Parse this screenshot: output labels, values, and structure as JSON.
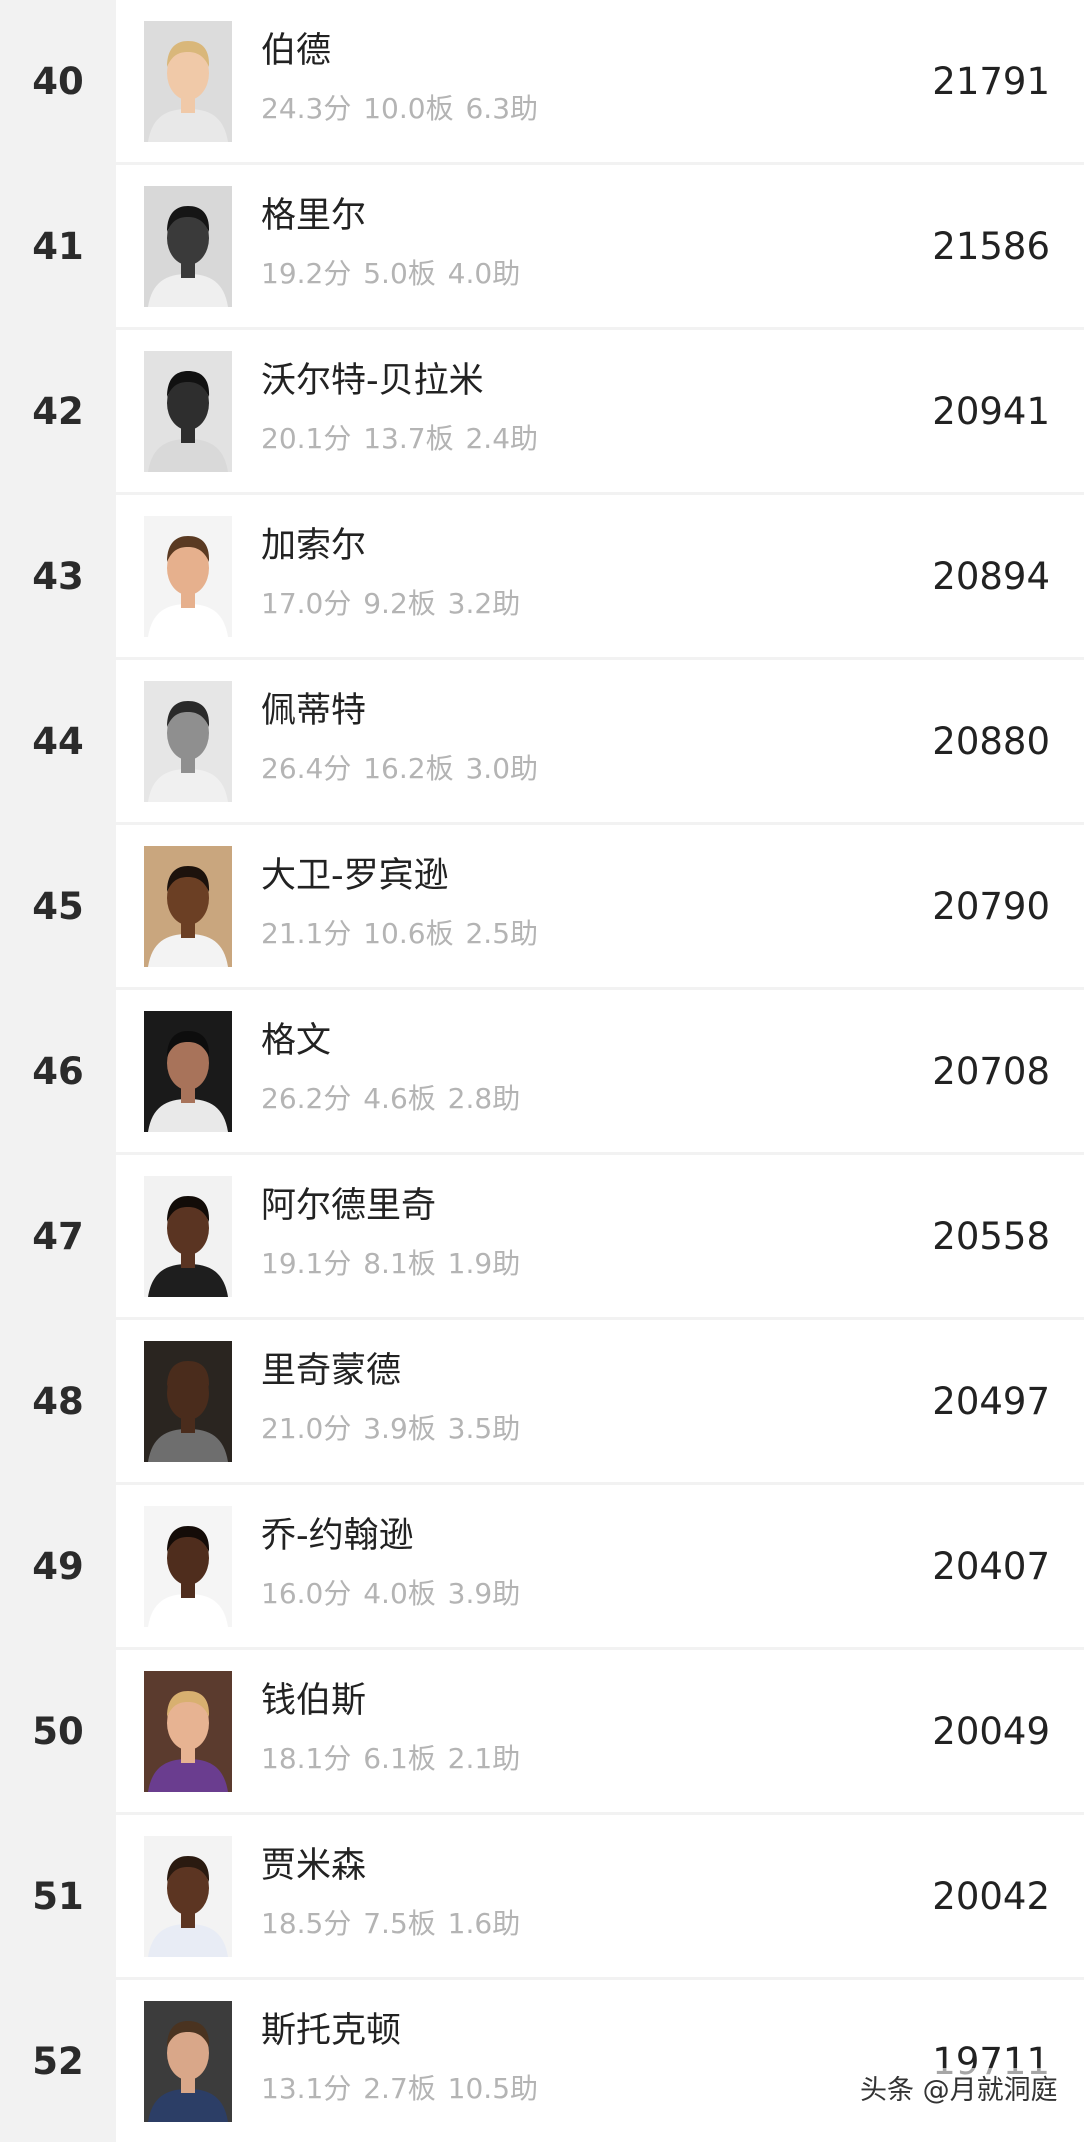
{
  "players": [
    {
      "rank": "40",
      "name": "伯德",
      "stats": "24.3分 10.0板 6.3助",
      "points": "21791",
      "photo": {
        "bg": "#dcdcdc",
        "skin": "#f0c9a8",
        "hair": "#d9b77a",
        "jersey": "#e8e8e8"
      }
    },
    {
      "rank": "41",
      "name": "格里尔",
      "stats": "19.2分 5.0板 4.0助",
      "points": "21586",
      "photo": {
        "bg": "#d8d8d8",
        "skin": "#3a3a3a",
        "hair": "#151515",
        "jersey": "#efefef"
      }
    },
    {
      "rank": "42",
      "name": "沃尔特-贝拉米",
      "stats": "20.1分 13.7板 2.4助",
      "points": "20941",
      "photo": {
        "bg": "#e2e2e2",
        "skin": "#2e2e2e",
        "hair": "#111111",
        "jersey": "#d9d9d9"
      }
    },
    {
      "rank": "43",
      "name": "加索尔",
      "stats": "17.0分 9.2板 3.2助",
      "points": "20894",
      "photo": {
        "bg": "#f4f4f4",
        "skin": "#e6b08d",
        "hair": "#5a3a22",
        "jersey": "#ffffff"
      }
    },
    {
      "rank": "44",
      "name": "佩蒂特",
      "stats": "26.4分 16.2板 3.0助",
      "points": "20880",
      "photo": {
        "bg": "#e6e6e6",
        "skin": "#8f8f8f",
        "hair": "#2a2a2a",
        "jersey": "#f0f0f0"
      }
    },
    {
      "rank": "45",
      "name": "大卫-罗宾逊",
      "stats": "21.1分 10.6板 2.5助",
      "points": "20790",
      "photo": {
        "bg": "#c9a67e",
        "skin": "#6b3f24",
        "hair": "#1c120c",
        "jersey": "#f3f3f3"
      }
    },
    {
      "rank": "46",
      "name": "格文",
      "stats": "26.2分 4.6板 2.8助",
      "points": "20708",
      "photo": {
        "bg": "#1a1a1a",
        "skin": "#a8735a",
        "hair": "#0d0d0d",
        "jersey": "#e9e9e9"
      }
    },
    {
      "rank": "47",
      "name": "阿尔德里奇",
      "stats": "19.1分 8.1板 1.9助",
      "points": "20558",
      "photo": {
        "bg": "#f2f2f2",
        "skin": "#5a3422",
        "hair": "#120c08",
        "jersey": "#1e1e1e"
      }
    },
    {
      "rank": "48",
      "name": "里奇蒙德",
      "stats": "21.0分 3.9板 3.5助",
      "points": "20497",
      "photo": {
        "bg": "#2a2520",
        "skin": "#4a2c1c",
        "hair": "#4a2c1c",
        "jersey": "#6e6e6e"
      }
    },
    {
      "rank": "49",
      "name": "乔-约翰逊",
      "stats": "16.0分 4.0板 3.9助",
      "points": "20407",
      "photo": {
        "bg": "#f5f5f5",
        "skin": "#4f2d1d",
        "hair": "#140c08",
        "jersey": "#ffffff"
      }
    },
    {
      "rank": "50",
      "name": "钱伯斯",
      "stats": "18.1分 6.1板 2.1助",
      "points": "20049",
      "photo": {
        "bg": "#5b3b2e",
        "skin": "#e7b392",
        "hair": "#d8b070",
        "jersey": "#6a3d8f"
      }
    },
    {
      "rank": "51",
      "name": "贾米森",
      "stats": "18.5分 7.5板 1.6助",
      "points": "20042",
      "photo": {
        "bg": "#f3f3f3",
        "skin": "#5c3522",
        "hair": "#2a1a10",
        "jersey": "#e8ecf5"
      }
    },
    {
      "rank": "52",
      "name": "斯托克顿",
      "stats": "13.1分 2.7板 10.5助",
      "points": "19711",
      "photo": {
        "bg": "#3c3c3c",
        "skin": "#d9a789",
        "hair": "#4a3320",
        "jersey": "#2c3e66"
      }
    }
  ],
  "watermark": "头条 @月就洞庭"
}
